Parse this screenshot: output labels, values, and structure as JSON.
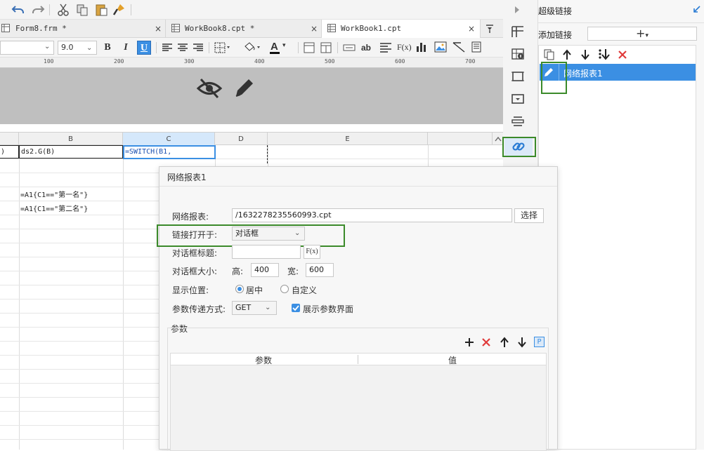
{
  "panel": {
    "title": "超级链接",
    "add_label": "添加链接",
    "add_button": "+",
    "link_item": "网络报表1"
  },
  "tabs": [
    {
      "label": "Form8.frm *",
      "close": "×"
    },
    {
      "label": "WorkBook8.cpt *",
      "close": "×"
    },
    {
      "label": "WorkBook1.cpt",
      "close": "×"
    }
  ],
  "format": {
    "font_size": "9.0",
    "bold": "B",
    "italic": "I",
    "underline": "U",
    "text_color_letter": "A",
    "ab_label": "ab",
    "fx_label": "F(x)"
  },
  "ruler": [
    "100",
    "200",
    "300",
    "400",
    "500",
    "600",
    "700"
  ],
  "columns": [
    "B",
    "C",
    "D",
    "E"
  ],
  "cells": {
    "a1": ")",
    "b1": "ds2.G(B)",
    "c1": "=SWITCH(B1,",
    "b4": "=A1{C1==\"第一名\"}",
    "b5": "=A1{C1==\"第二名\"}"
  },
  "dialog": {
    "title": "网络报表1",
    "report_label": "网络报表:",
    "report_value": "/1632278235560993.cpt",
    "choose_button": "选择",
    "open_in_label": "链接打开于:",
    "open_in_value": "对话框",
    "dialog_title_label": "对话框标题:",
    "fx_button": "F(x)",
    "size_label": "对话框大小:",
    "height_label": "高:",
    "height_value": "400",
    "width_label": "宽:",
    "width_value": "600",
    "position_label": "显示位置:",
    "position_center": "居中",
    "position_custom": "自定义",
    "position_selected": "居中",
    "param_method_label": "参数传递方式:",
    "param_method_value": "GET",
    "show_params_label": "展示参数界面",
    "show_params_checked": true,
    "params_section": "参数",
    "table_headers": [
      "参数",
      "值"
    ]
  },
  "colors": {
    "accent": "#3b8fe3",
    "highlight_green": "#3b8a2a",
    "delete_red": "#e03a3a"
  }
}
